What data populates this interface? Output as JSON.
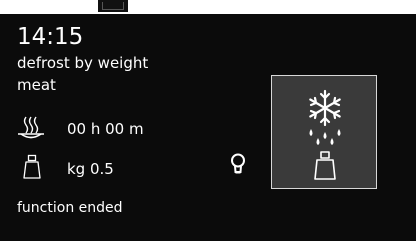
{
  "display": {
    "time": "14:15",
    "program": "defrost by weight",
    "food_type": "meat",
    "duration": "00 h 00 m",
    "weight": "kg 0.5",
    "status": "function ended"
  },
  "icons": {
    "duration": "heating-dish-icon",
    "weight": "weight-icon",
    "light": "light-bulb-icon",
    "function": "defrost-snowflake-weight-icon"
  },
  "colors": {
    "background": "#0b0b0b",
    "text": "#ffffff",
    "function_box": "#3a3a3a"
  }
}
